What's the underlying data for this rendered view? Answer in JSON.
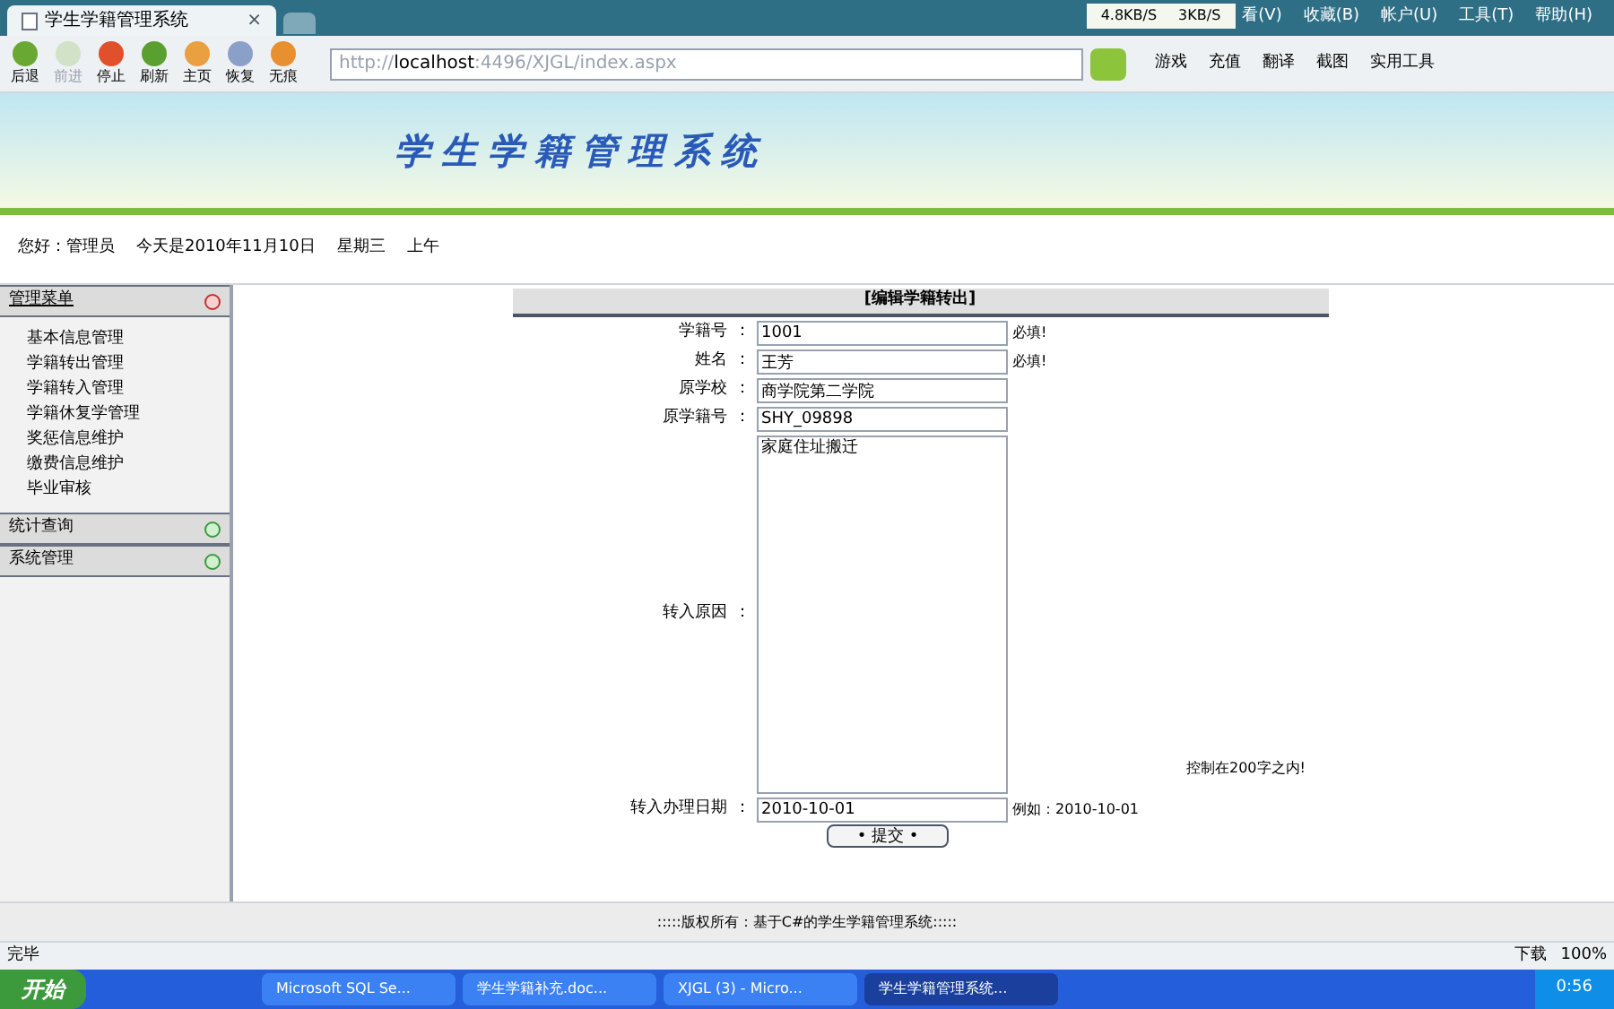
{
  "browser": {
    "tab_title": "学生学籍管理系统",
    "tab_close": "×",
    "speed_down": "4.8KB/S",
    "speed_up": "3KB/S",
    "menu": [
      "看(V)",
      "收藏(B)",
      "帐户(U)",
      "工具(T)",
      "帮助(H)"
    ],
    "nav_buttons": [
      {
        "label": "后退",
        "kind": "back",
        "disabled": false
      },
      {
        "label": "前进",
        "kind": "forward",
        "disabled": true
      },
      {
        "label": "停止",
        "kind": "stop",
        "disabled": false
      },
      {
        "label": "刷新",
        "kind": "refresh",
        "disabled": false
      },
      {
        "label": "主页",
        "kind": "home",
        "disabled": false
      },
      {
        "label": "恢复",
        "kind": "restore",
        "disabled": false
      },
      {
        "label": "无痕",
        "kind": "private",
        "disabled": false
      }
    ],
    "address": {
      "prefix": "http://",
      "host": "localhost",
      "rest": ":4496/XJGL/index.aspx"
    },
    "tools": [
      "游戏",
      "充值",
      "翻译",
      "截图",
      "实用工具"
    ]
  },
  "banner": {
    "title": "学生学籍管理系统"
  },
  "greeting": {
    "user": "您好：管理员",
    "date": "今天是2010年11月10日",
    "weekday": "星期三",
    "period": "上午"
  },
  "sidebar": [
    {
      "title": "管理菜单",
      "expanded": true,
      "items": [
        "基本信息管理",
        "学籍转出管理",
        "学籍转入管理",
        "学籍休复学管理",
        "奖惩信息维护",
        "缴费信息维护",
        "毕业审核"
      ]
    },
    {
      "title": "统计查询",
      "expanded": false
    },
    {
      "title": "系统管理",
      "expanded": false
    }
  ],
  "form": {
    "title": "[编辑学籍转出]",
    "fields": [
      {
        "label": "学籍号",
        "colon": "：",
        "kind": "text",
        "value": "1001",
        "hint": "必填!"
      },
      {
        "label": "姓名",
        "colon": "：",
        "kind": "text",
        "value": "王芳",
        "hint": "必填!"
      },
      {
        "label": "原学校",
        "colon": "：",
        "kind": "text",
        "value": "商学院第二学院"
      },
      {
        "label": "原学籍号",
        "colon": "：",
        "kind": "text",
        "value": "SHY_09898"
      },
      {
        "label": "转入原因",
        "colon": "：",
        "kind": "textarea",
        "value": "家庭住址搬迁",
        "hint": "控制在200字之内!"
      },
      {
        "label": "转入办理日期",
        "colon": "：",
        "kind": "text",
        "value": "2010-10-01",
        "hint": "例如：2010-10-01"
      }
    ],
    "submit": "• 提交 •"
  },
  "footer": ":::::版权所有：基于C#的学生学籍管理系统:::::",
  "status_bar": {
    "text": "完毕",
    "download": "下载",
    "zoom": "100%"
  },
  "taskbar": {
    "start": "开始",
    "tasks": [
      {
        "label": "Microsoft SQL Se...",
        "selected": false
      },
      {
        "label": "学生学籍补充.doc...",
        "selected": false
      },
      {
        "label": "XJGL (3) - Micro...",
        "selected": false
      },
      {
        "label": "学生学籍管理系统...",
        "selected": true
      }
    ],
    "time": "0:56"
  }
}
